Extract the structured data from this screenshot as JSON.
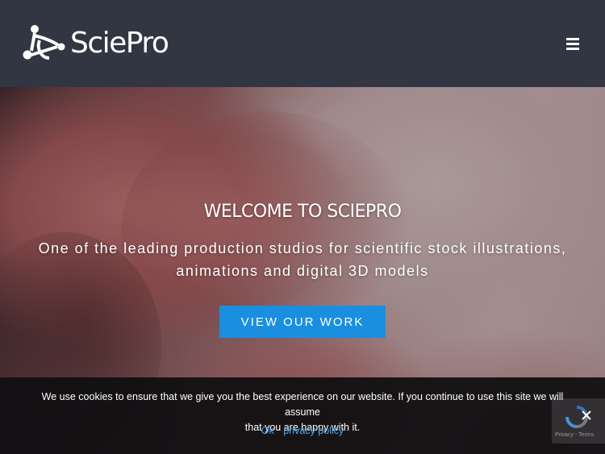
{
  "header": {
    "logo_text": "SciePro",
    "menu_icon": "hamburger-menu-icon"
  },
  "hero": {
    "title": "WELCOME TO SCIEPRO",
    "subtitle_line1": "One of the leading production studios for scientific stock illustrations,",
    "subtitle_line2": "animations and digital 3D models",
    "cta_label": "VIEW OUR WORK"
  },
  "cookie_bar": {
    "message_line1": "We use cookies to ensure that we give you the best experience on our website. If you continue to use this site we will assume",
    "message_line2": "that you are happy with it.",
    "ok_label": "Ok",
    "privacy_label": "privacy policy"
  },
  "recaptcha": {
    "links_text": "Privacy - Terms"
  },
  "colors": {
    "header_bg": "#323643",
    "accent": "#1a8fe0",
    "link": "#4aa6f0",
    "cookie_bg": "#0e0e10"
  }
}
